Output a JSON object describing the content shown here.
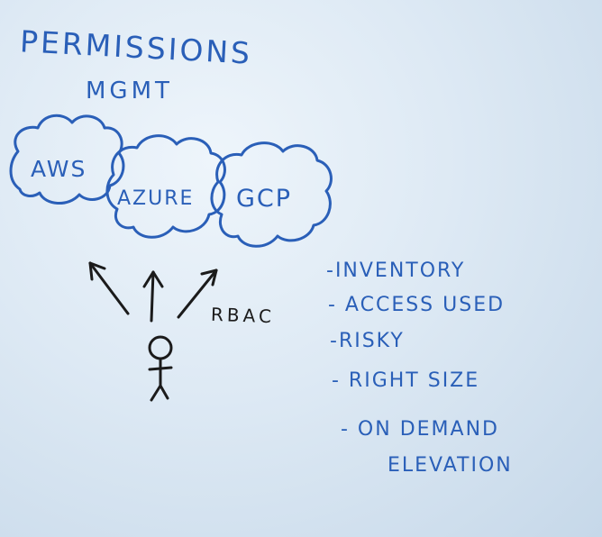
{
  "title": {
    "line1": "Permissions",
    "line2": "MGMT"
  },
  "clouds": {
    "aws": "AWS",
    "azure": "Azure",
    "gcp": "GCP"
  },
  "access_label": "RBAC",
  "features": [
    "-Inventory",
    "- Access used",
    "-Risky",
    "- Right size",
    "- On demand",
    "Elevation"
  ],
  "colors": {
    "marker_blue": "#2a5fb8",
    "marker_black": "#1b1b1b",
    "board": "#dde9f4"
  }
}
